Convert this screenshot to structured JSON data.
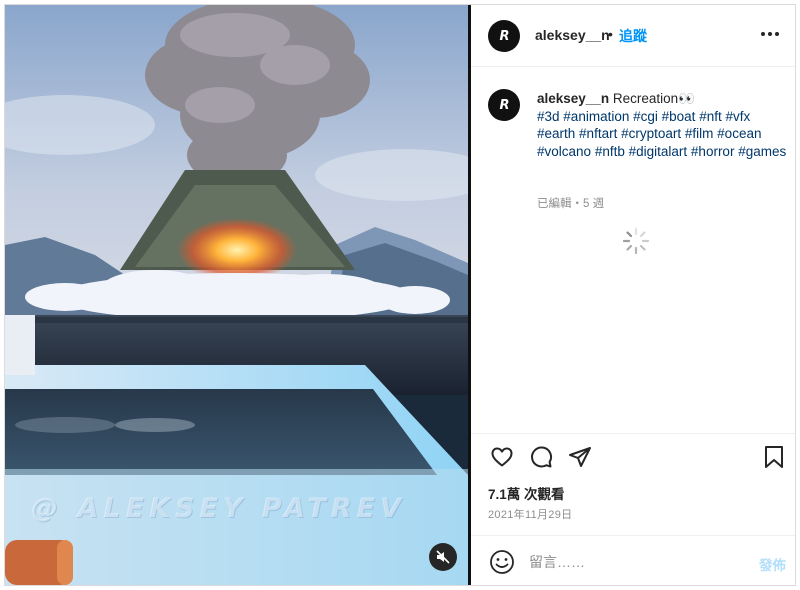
{
  "post": {
    "username": "aleksey__n",
    "avatar_initials": "R",
    "separator": "•",
    "follow_label": "追蹤",
    "more_icon": "more-horizontal-icon"
  },
  "media": {
    "watermark": "@ ALEKSEY PATREV",
    "mute_icon": "speaker-muted-icon"
  },
  "caption": {
    "username": "aleksey__n",
    "title": "Recreation👀",
    "hashtags": [
      "#3d",
      "#animation",
      "#cgi",
      "#boat",
      "#nft",
      "#vfx",
      "#earth",
      "#nftart",
      "#cryptoart",
      "#film",
      "#ocean",
      "#volcano",
      "#nftb",
      "#digitalart",
      "#horror",
      "#games"
    ],
    "meta": "已編輯・5 週"
  },
  "actions": {
    "like_icon": "heart-icon",
    "comment_icon": "comment-icon",
    "share_icon": "paper-plane-icon",
    "save_icon": "bookmark-icon"
  },
  "stats": {
    "views": "7.1萬 次觀看",
    "date": "2021年11月29日"
  },
  "comment": {
    "placeholder": "留言……",
    "post_label": "發佈",
    "emoji_icon": "emoji-smile-icon"
  },
  "colors": {
    "accent": "#0095f6",
    "hashtag": "#00376b",
    "muted": "#8e8e8e",
    "post_disabled": "#b2dffc"
  }
}
